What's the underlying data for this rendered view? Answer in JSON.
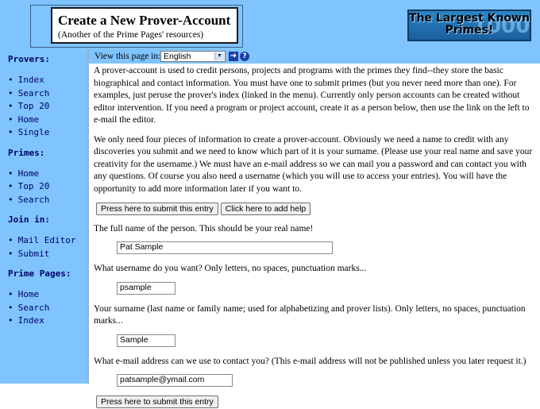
{
  "header": {
    "title": "Create a New Prover-Account",
    "subtitle": "(Another of the Prime Pages' resources)",
    "logo_text": "The Largest Known Primes!"
  },
  "sidebar": {
    "sections": [
      {
        "heading": "Provers:",
        "items": [
          "Index",
          "Search",
          "Top 20",
          "Home",
          "Single"
        ]
      },
      {
        "heading": "Primes:",
        "items": [
          "Home",
          "Top 20",
          "Search"
        ]
      },
      {
        "heading": "Join in:",
        "items": [
          "Mail Editor",
          "Submit"
        ]
      },
      {
        "heading": "Prime Pages:",
        "items": [
          "Home",
          "Search",
          "Index"
        ]
      }
    ]
  },
  "langbar": {
    "label": "View this page in:",
    "selected": "English",
    "go_icon": "arrow-right-icon",
    "help_icon": "help-icon"
  },
  "content": {
    "intro1": "A prover-account is used to credit persons, projects and programs with the primes they find--they store the basic biographical and contact information. You must have one to submit primes (but you never need more than one). For examples, just peruse the prover's index (linked in the menu). Currently only person accounts can be created without editor intervention. If you need a program or project account, create it as a person below, then use the link on the left to e-mail the editor.",
    "intro2": "We only need four pieces of information to create a prover-account. Obviously we need a name to credit with any discoveries you submit and we need to know which part of it is your surname. (Please use your real name and save your creativity for the username.) We must have an e-mail address so we can mail you a password and can contact you with any questions. Of course you also need a username (which you will use to access your entries). You will have the opportunity to add more information later if you want to.",
    "submit_button": "Press here to submit this entry",
    "help_button": "Click here to add help",
    "fullname_label": "The full name of the person. This should be your real name!",
    "fullname_value": "Pat Sample",
    "username_label": "What username do you want?  Only letters, no spaces, punctuation marks...",
    "username_value": "psample",
    "surname_label": "Your surname (last name or family name; used for alphabetizing and prover lists). Only letters, no spaces, punctuation marks...",
    "surname_value": "Sample",
    "email_label": "What e-mail address can we use to contact you? (This e-mail address will not be published unless you later request it.)",
    "email_value": "patsample@ymail.com",
    "submit_button_bottom": "Press here to submit this entry"
  },
  "colors": {
    "sidebar_bg": "#7fc4ff",
    "link": "#000066"
  }
}
